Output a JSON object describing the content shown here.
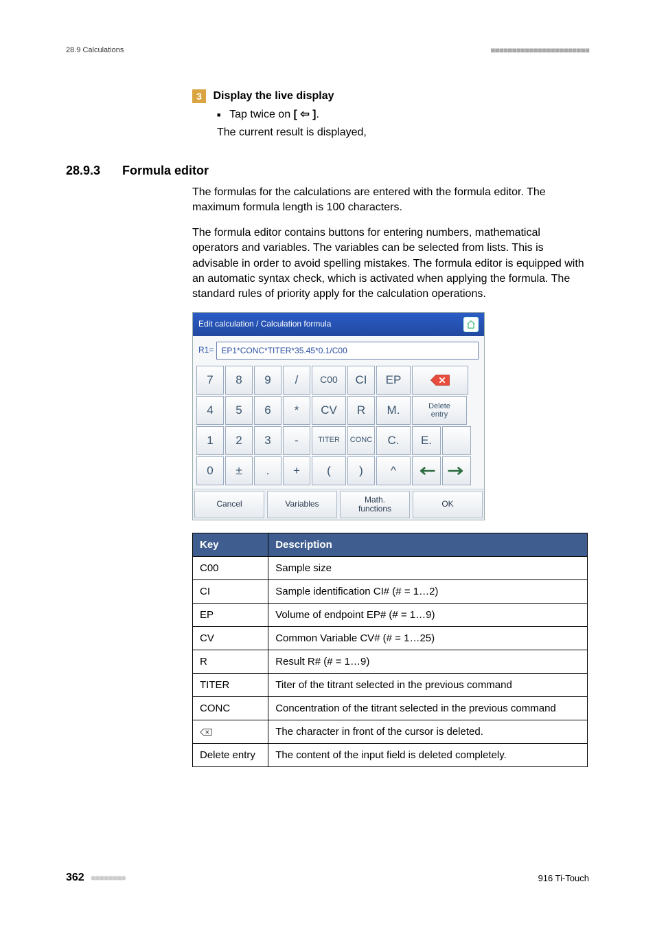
{
  "header": {
    "left": "28.9 Calculations",
    "bars": "■■■■■■■■■■■■■■■■■■■■■■■"
  },
  "step": {
    "num": "3",
    "title": "Display the live display",
    "bullet_pre": "Tap twice on ",
    "bullet_key": "[ ⇦ ]",
    "bullet_post": ".",
    "result": "The current result is displayed,"
  },
  "section": {
    "num": "28.9.3",
    "title": "Formula editor"
  },
  "para1": "The formulas for the calculations are entered with the formula editor. The maximum formula length is 100 characters.",
  "para2": "The formula editor contains buttons for entering numbers, mathematical operators and variables. The variables can be selected from lists. This is advisable in order to avoid spelling mistakes. The formula editor is equipped with an automatic syntax check, which is activated when applying the formula. The standard rules of priority apply for the calculation operations.",
  "fe": {
    "title": "Edit calculation / Calculation formula",
    "r1": "R1=",
    "formula": "EP1*CONC*TITER*35.45*0.1/C00",
    "rows": [
      [
        "7",
        "8",
        "9",
        "/",
        "C00",
        "CI",
        "EP"
      ],
      [
        "4",
        "5",
        "6",
        "*",
        "CV",
        "R",
        "M."
      ],
      [
        "1",
        "2",
        "3",
        "-",
        "TITER",
        "CONC",
        "C."
      ],
      [
        "0",
        "±",
        ".",
        "+",
        "(",
        ")",
        "^"
      ]
    ],
    "delete_entry": "Delete entry",
    "e_label": "E.",
    "bottom": {
      "cancel": "Cancel",
      "variables": "Variables",
      "math": "Math. functions",
      "ok": "OK"
    }
  },
  "table": {
    "head_key": "Key",
    "head_desc": "Description",
    "rows": [
      {
        "key": "C00",
        "desc": "Sample size"
      },
      {
        "key": "CI",
        "desc": "Sample identification CI# (# = 1…2)"
      },
      {
        "key": "EP",
        "desc": "Volume of endpoint EP# (# = 1…9)"
      },
      {
        "key": "CV",
        "desc": "Common Variable CV# (# = 1…25)"
      },
      {
        "key": "R",
        "desc": "Result R# (# = 1…9)"
      },
      {
        "key": "TITER",
        "desc": "Titer of the titrant selected in the previous command"
      },
      {
        "key": "CONC",
        "desc": "Concentration of the titrant selected in the previous command"
      },
      {
        "key": "__BACKSPACE__",
        "desc": "The character in front of the cursor is deleted."
      },
      {
        "key": "Delete entry",
        "desc": "The content of the input field is deleted completely."
      }
    ]
  },
  "footer": {
    "page": "362",
    "bars": "■■■■■■■■",
    "product": "916 Ti-Touch"
  }
}
